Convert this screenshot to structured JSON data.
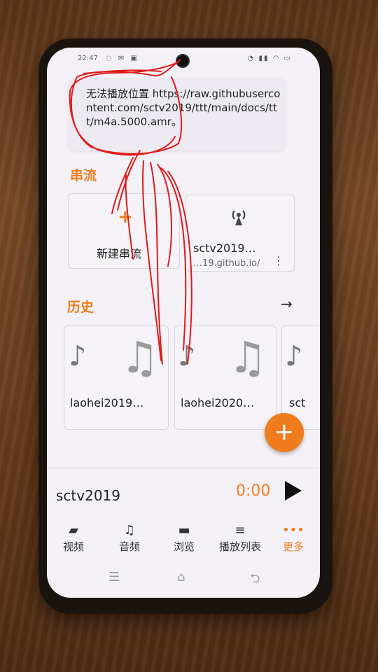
{
  "status_bar": {
    "time": "22:47"
  },
  "snackbar": {
    "message": "无法播放位置 https://raw.githubusercontent.com/sctv2019/ttt/main/docs/ttt/m4a.5000.amr。"
  },
  "streams": {
    "title": "串流",
    "new_stream_label": "新建串流",
    "items": [
      {
        "name": "sctv2019…",
        "url": "…19.github.io/"
      }
    ]
  },
  "history": {
    "title": "历史",
    "items": [
      {
        "name": "laohei2019…"
      },
      {
        "name": "laohei2020…"
      },
      {
        "name": "sct"
      }
    ]
  },
  "mini_player": {
    "title": "sctv2019",
    "time": "0:00"
  },
  "bottom_nav": {
    "items": [
      {
        "label": "视频",
        "icon": "video-icon"
      },
      {
        "label": "音频",
        "icon": "music-note-icon"
      },
      {
        "label": "浏览",
        "icon": "folder-icon"
      },
      {
        "label": "播放列表",
        "icon": "playlist-icon"
      },
      {
        "label": "更多",
        "icon": "more-dots-icon"
      }
    ]
  },
  "colors": {
    "accent": "#ef7d1e",
    "background": "#f3f1f6",
    "annotation": "#e01a1a"
  }
}
